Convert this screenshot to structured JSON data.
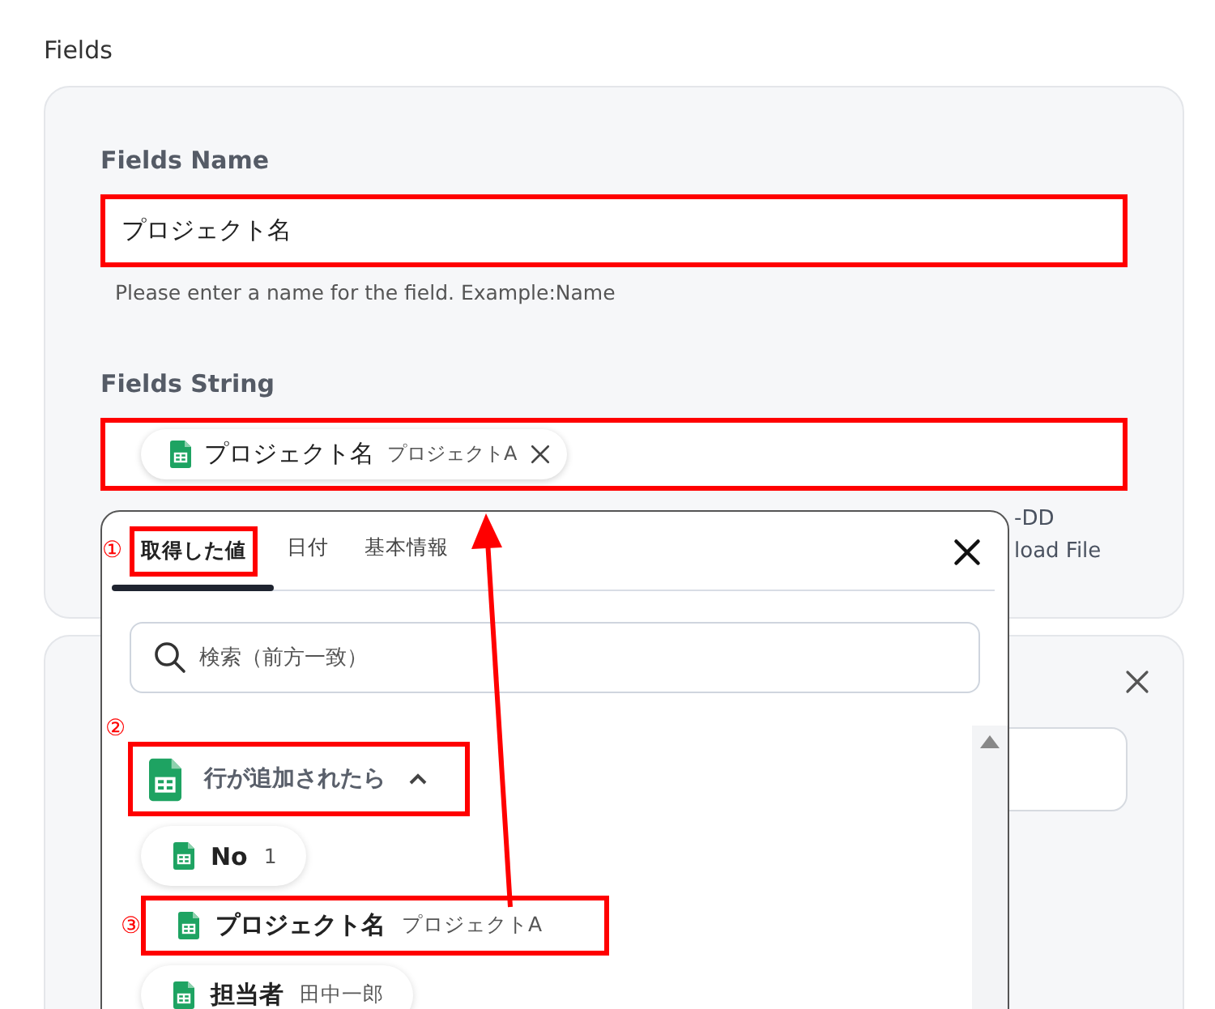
{
  "section_title": "Fields",
  "fields_name": {
    "label": "Fields Name",
    "value": "プロジェクト名",
    "hint": "Please enter a name for the field. Example:Name",
    "highlighted": true
  },
  "fields_string": {
    "label": "Fields String",
    "highlighted": true,
    "chip": {
      "name": "プロジェクト名",
      "value": "プロジェクトA"
    },
    "hint_fragments": [
      "-DD",
      "load File"
    ]
  },
  "picker": {
    "tabs": [
      {
        "label": "取得した値",
        "selected": true,
        "marker": "①",
        "highlighted": true
      },
      {
        "label": "日付",
        "selected": false,
        "highlighted": false
      },
      {
        "label": "基本情報",
        "selected": false,
        "highlighted": false
      }
    ],
    "search": {
      "placeholder": "検索（前方一致）"
    },
    "group": {
      "marker": "②",
      "title": "行が追加されたら",
      "expanded": true,
      "highlighted": true
    },
    "items": [
      {
        "name": "No",
        "value": "1",
        "highlighted": false
      },
      {
        "marker": "③",
        "name": "プロジェクト名",
        "value": "プロジェクトA",
        "highlighted": true
      },
      {
        "name": "担当者",
        "value": "田中一郎",
        "highlighted": false
      }
    ]
  }
}
